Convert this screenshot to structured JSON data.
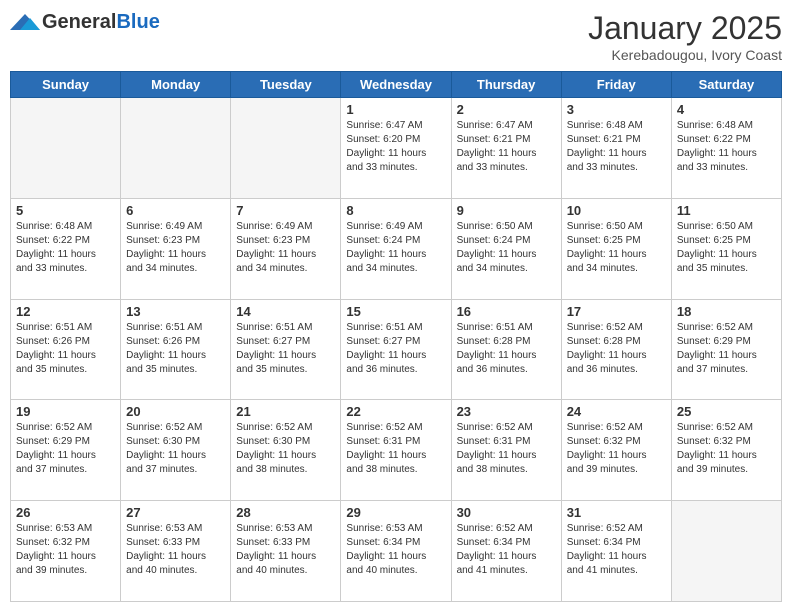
{
  "header": {
    "logo": {
      "general": "General",
      "blue": "Blue"
    },
    "title": "January 2025",
    "location": "Kerebadougou, Ivory Coast"
  },
  "days_of_week": [
    "Sunday",
    "Monday",
    "Tuesday",
    "Wednesday",
    "Thursday",
    "Friday",
    "Saturday"
  ],
  "weeks": [
    [
      {
        "day": "",
        "empty": true
      },
      {
        "day": "",
        "empty": true
      },
      {
        "day": "",
        "empty": true
      },
      {
        "day": "1",
        "sunrise": "Sunrise: 6:47 AM",
        "sunset": "Sunset: 6:20 PM",
        "daylight": "Daylight: 11 hours and 33 minutes."
      },
      {
        "day": "2",
        "sunrise": "Sunrise: 6:47 AM",
        "sunset": "Sunset: 6:21 PM",
        "daylight": "Daylight: 11 hours and 33 minutes."
      },
      {
        "day": "3",
        "sunrise": "Sunrise: 6:48 AM",
        "sunset": "Sunset: 6:21 PM",
        "daylight": "Daylight: 11 hours and 33 minutes."
      },
      {
        "day": "4",
        "sunrise": "Sunrise: 6:48 AM",
        "sunset": "Sunset: 6:22 PM",
        "daylight": "Daylight: 11 hours and 33 minutes."
      }
    ],
    [
      {
        "day": "5",
        "sunrise": "Sunrise: 6:48 AM",
        "sunset": "Sunset: 6:22 PM",
        "daylight": "Daylight: 11 hours and 33 minutes."
      },
      {
        "day": "6",
        "sunrise": "Sunrise: 6:49 AM",
        "sunset": "Sunset: 6:23 PM",
        "daylight": "Daylight: 11 hours and 34 minutes."
      },
      {
        "day": "7",
        "sunrise": "Sunrise: 6:49 AM",
        "sunset": "Sunset: 6:23 PM",
        "daylight": "Daylight: 11 hours and 34 minutes."
      },
      {
        "day": "8",
        "sunrise": "Sunrise: 6:49 AM",
        "sunset": "Sunset: 6:24 PM",
        "daylight": "Daylight: 11 hours and 34 minutes."
      },
      {
        "day": "9",
        "sunrise": "Sunrise: 6:50 AM",
        "sunset": "Sunset: 6:24 PM",
        "daylight": "Daylight: 11 hours and 34 minutes."
      },
      {
        "day": "10",
        "sunrise": "Sunrise: 6:50 AM",
        "sunset": "Sunset: 6:25 PM",
        "daylight": "Daylight: 11 hours and 34 minutes."
      },
      {
        "day": "11",
        "sunrise": "Sunrise: 6:50 AM",
        "sunset": "Sunset: 6:25 PM",
        "daylight": "Daylight: 11 hours and 35 minutes."
      }
    ],
    [
      {
        "day": "12",
        "sunrise": "Sunrise: 6:51 AM",
        "sunset": "Sunset: 6:26 PM",
        "daylight": "Daylight: 11 hours and 35 minutes."
      },
      {
        "day": "13",
        "sunrise": "Sunrise: 6:51 AM",
        "sunset": "Sunset: 6:26 PM",
        "daylight": "Daylight: 11 hours and 35 minutes."
      },
      {
        "day": "14",
        "sunrise": "Sunrise: 6:51 AM",
        "sunset": "Sunset: 6:27 PM",
        "daylight": "Daylight: 11 hours and 35 minutes."
      },
      {
        "day": "15",
        "sunrise": "Sunrise: 6:51 AM",
        "sunset": "Sunset: 6:27 PM",
        "daylight": "Daylight: 11 hours and 36 minutes."
      },
      {
        "day": "16",
        "sunrise": "Sunrise: 6:51 AM",
        "sunset": "Sunset: 6:28 PM",
        "daylight": "Daylight: 11 hours and 36 minutes."
      },
      {
        "day": "17",
        "sunrise": "Sunrise: 6:52 AM",
        "sunset": "Sunset: 6:28 PM",
        "daylight": "Daylight: 11 hours and 36 minutes."
      },
      {
        "day": "18",
        "sunrise": "Sunrise: 6:52 AM",
        "sunset": "Sunset: 6:29 PM",
        "daylight": "Daylight: 11 hours and 37 minutes."
      }
    ],
    [
      {
        "day": "19",
        "sunrise": "Sunrise: 6:52 AM",
        "sunset": "Sunset: 6:29 PM",
        "daylight": "Daylight: 11 hours and 37 minutes."
      },
      {
        "day": "20",
        "sunrise": "Sunrise: 6:52 AM",
        "sunset": "Sunset: 6:30 PM",
        "daylight": "Daylight: 11 hours and 37 minutes."
      },
      {
        "day": "21",
        "sunrise": "Sunrise: 6:52 AM",
        "sunset": "Sunset: 6:30 PM",
        "daylight": "Daylight: 11 hours and 38 minutes."
      },
      {
        "day": "22",
        "sunrise": "Sunrise: 6:52 AM",
        "sunset": "Sunset: 6:31 PM",
        "daylight": "Daylight: 11 hours and 38 minutes."
      },
      {
        "day": "23",
        "sunrise": "Sunrise: 6:52 AM",
        "sunset": "Sunset: 6:31 PM",
        "daylight": "Daylight: 11 hours and 38 minutes."
      },
      {
        "day": "24",
        "sunrise": "Sunrise: 6:52 AM",
        "sunset": "Sunset: 6:32 PM",
        "daylight": "Daylight: 11 hours and 39 minutes."
      },
      {
        "day": "25",
        "sunrise": "Sunrise: 6:52 AM",
        "sunset": "Sunset: 6:32 PM",
        "daylight": "Daylight: 11 hours and 39 minutes."
      }
    ],
    [
      {
        "day": "26",
        "sunrise": "Sunrise: 6:53 AM",
        "sunset": "Sunset: 6:32 PM",
        "daylight": "Daylight: 11 hours and 39 minutes."
      },
      {
        "day": "27",
        "sunrise": "Sunrise: 6:53 AM",
        "sunset": "Sunset: 6:33 PM",
        "daylight": "Daylight: 11 hours and 40 minutes."
      },
      {
        "day": "28",
        "sunrise": "Sunrise: 6:53 AM",
        "sunset": "Sunset: 6:33 PM",
        "daylight": "Daylight: 11 hours and 40 minutes."
      },
      {
        "day": "29",
        "sunrise": "Sunrise: 6:53 AM",
        "sunset": "Sunset: 6:34 PM",
        "daylight": "Daylight: 11 hours and 40 minutes."
      },
      {
        "day": "30",
        "sunrise": "Sunrise: 6:52 AM",
        "sunset": "Sunset: 6:34 PM",
        "daylight": "Daylight: 11 hours and 41 minutes."
      },
      {
        "day": "31",
        "sunrise": "Sunrise: 6:52 AM",
        "sunset": "Sunset: 6:34 PM",
        "daylight": "Daylight: 11 hours and 41 minutes."
      },
      {
        "day": "",
        "empty": true
      }
    ]
  ]
}
